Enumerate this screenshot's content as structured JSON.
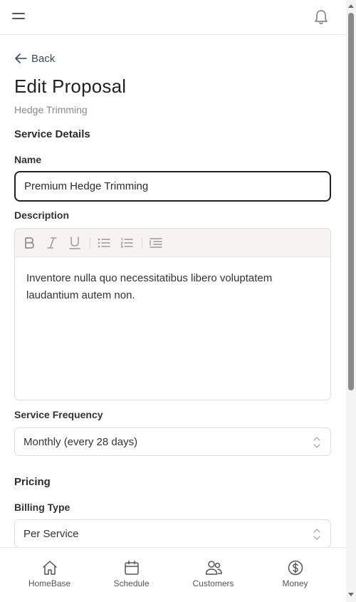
{
  "header": {
    "menu_icon": "hamburger-menu-icon",
    "notifications_icon": "bell-icon"
  },
  "back": {
    "label": "Back",
    "icon": "arrow-left-icon"
  },
  "page": {
    "title": "Edit Proposal",
    "subtitle": "Hedge Trimming"
  },
  "service_details": {
    "section_title": "Service Details",
    "name_label": "Name",
    "name_value": "Premium Hedge Trimming",
    "description_label": "Description",
    "description_text": "Inventore nulla quo necessitatibus libero voluptatem laudantium autem non.",
    "toolbar": [
      "bold-icon",
      "italic-icon",
      "underline-icon",
      "bullet-list-icon",
      "numbered-list-icon",
      "indent-icon"
    ],
    "frequency_label": "Service Frequency",
    "frequency_value": "Monthly (every 28 days)"
  },
  "pricing": {
    "section_title": "Pricing",
    "billing_type_label": "Billing Type",
    "billing_type_value": "Per Service"
  },
  "bottom_nav": {
    "items": [
      {
        "label": "HomeBase",
        "icon": "home-icon"
      },
      {
        "label": "Schedule",
        "icon": "calendar-icon"
      },
      {
        "label": "Customers",
        "icon": "users-icon"
      },
      {
        "label": "Money",
        "icon": "dollar-circle-icon"
      }
    ]
  },
  "colors": {
    "accent_border": "#222222",
    "muted_text": "#8a8a8a",
    "link_text": "#3a4a5c"
  }
}
